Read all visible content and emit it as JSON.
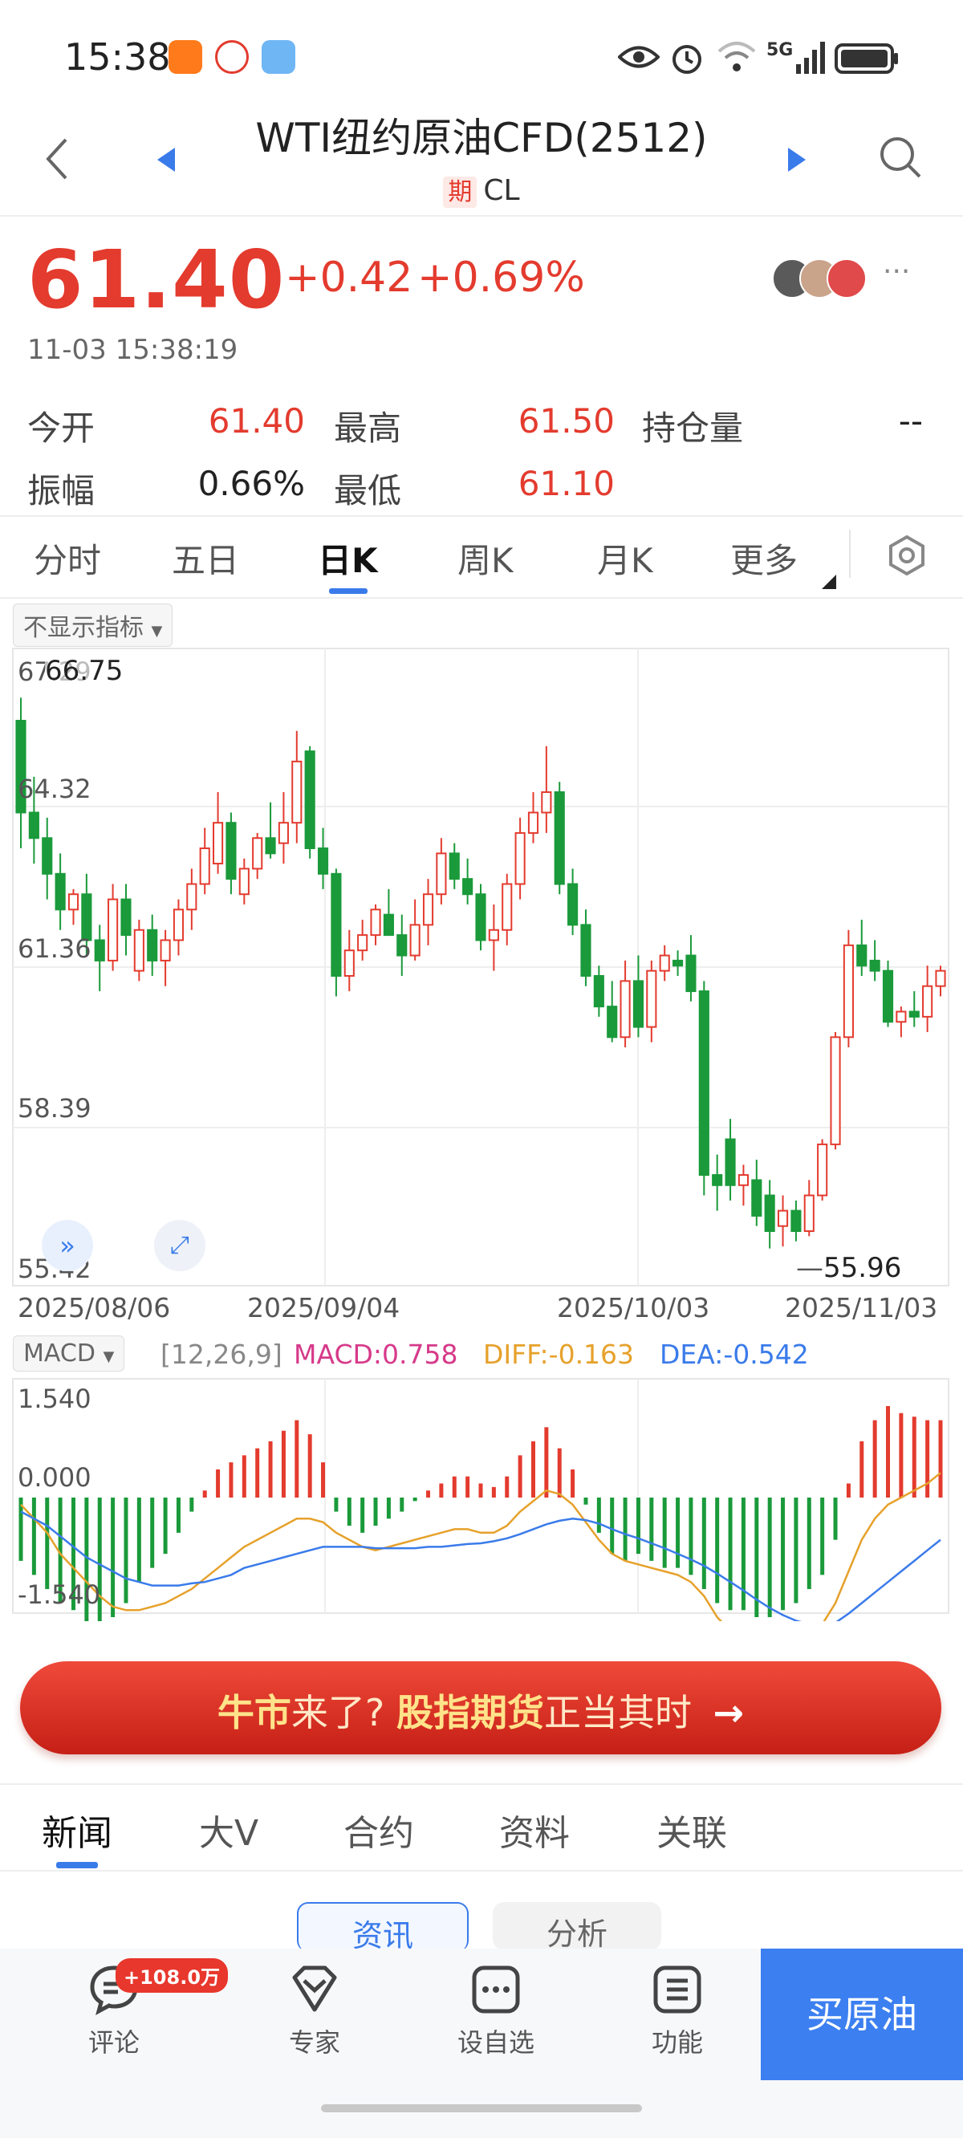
{
  "status": {
    "time": "15:38",
    "network": "5G"
  },
  "header": {
    "title": "WTI纽约原油CFD(2512)",
    "tag": "期",
    "code": "CL"
  },
  "quote": {
    "price": "61.40",
    "change": "+0.42",
    "change_pct": "+0.69%",
    "time": "11-03 15:38:19",
    "stats": [
      {
        "label": "今开",
        "value": "61.40",
        "color": "#e33b2e"
      },
      {
        "label": "最高",
        "value": "61.50",
        "color": "#e33b2e"
      },
      {
        "label": "持仓量",
        "value": "--",
        "color": "#222222"
      },
      {
        "label": "振幅",
        "value": "0.66%",
        "color": "#222222"
      },
      {
        "label": "最低",
        "value": "61.10",
        "color": "#e33b2e"
      }
    ]
  },
  "tabs": [
    "分时",
    "五日",
    "日K",
    "周K",
    "月K",
    "更多"
  ],
  "active_tab": "日K",
  "chart": {
    "indicator_toggle": "不显示指标",
    "y_ticks": [
      "67.29",
      "64.32",
      "61.36",
      "58.39",
      "55.42"
    ],
    "high_label": "66.75",
    "low_label": "55.96",
    "x_ticks": [
      "2025/08/06",
      "2025/09/04",
      "2025/10/03",
      "2025/11/03"
    ],
    "macd": {
      "selector": "MACD",
      "params": "[12,26,9]",
      "macd_label": "MACD:0.758",
      "diff_label": "DIFF:-0.163",
      "dea_label": "DEA:-0.542",
      "y_ticks": [
        "1.540",
        "0.000",
        "-1.540"
      ]
    }
  },
  "chart_data": {
    "type": "candlestick",
    "price_range": [
      55.42,
      67.29
    ],
    "up_color": "#e33b2e",
    "down_color": "#1a9a3a",
    "candles": [
      {
        "o": 66.3,
        "h": 66.75,
        "l": 63.8,
        "c": 64.5
      },
      {
        "o": 64.5,
        "h": 65.2,
        "l": 63.5,
        "c": 64.0
      },
      {
        "o": 64.0,
        "h": 64.4,
        "l": 62.8,
        "c": 63.3
      },
      {
        "o": 63.3,
        "h": 63.7,
        "l": 62.2,
        "c": 62.6
      },
      {
        "o": 62.6,
        "h": 63.0,
        "l": 62.3,
        "c": 62.9
      },
      {
        "o": 62.9,
        "h": 63.3,
        "l": 61.7,
        "c": 62.0
      },
      {
        "o": 62.0,
        "h": 62.3,
        "l": 61.0,
        "c": 61.6
      },
      {
        "o": 61.6,
        "h": 63.1,
        "l": 61.4,
        "c": 62.8
      },
      {
        "o": 62.8,
        "h": 63.1,
        "l": 61.7,
        "c": 62.1
      },
      {
        "o": 61.4,
        "h": 62.4,
        "l": 61.2,
        "c": 62.2
      },
      {
        "o": 62.2,
        "h": 62.5,
        "l": 61.3,
        "c": 61.6
      },
      {
        "o": 61.6,
        "h": 62.2,
        "l": 61.1,
        "c": 62.0
      },
      {
        "o": 62.0,
        "h": 62.8,
        "l": 61.7,
        "c": 62.6
      },
      {
        "o": 62.6,
        "h": 63.4,
        "l": 62.2,
        "c": 63.1
      },
      {
        "o": 63.1,
        "h": 64.2,
        "l": 62.9,
        "c": 63.8
      },
      {
        "o": 63.5,
        "h": 64.9,
        "l": 63.3,
        "c": 64.3
      },
      {
        "o": 64.3,
        "h": 64.5,
        "l": 62.9,
        "c": 63.2
      },
      {
        "o": 62.9,
        "h": 63.6,
        "l": 62.7,
        "c": 63.4
      },
      {
        "o": 63.4,
        "h": 64.1,
        "l": 63.2,
        "c": 64.0
      },
      {
        "o": 64.0,
        "h": 64.7,
        "l": 63.6,
        "c": 63.7
      },
      {
        "o": 63.9,
        "h": 64.9,
        "l": 63.5,
        "c": 64.3
      },
      {
        "o": 64.3,
        "h": 66.1,
        "l": 63.9,
        "c": 65.5
      },
      {
        "o": 65.7,
        "h": 65.8,
        "l": 63.6,
        "c": 63.8
      },
      {
        "o": 63.8,
        "h": 64.2,
        "l": 63.0,
        "c": 63.3
      },
      {
        "o": 63.3,
        "h": 63.4,
        "l": 60.9,
        "c": 61.3
      },
      {
        "o": 61.3,
        "h": 62.2,
        "l": 61.0,
        "c": 61.8
      },
      {
        "o": 61.8,
        "h": 62.4,
        "l": 61.6,
        "c": 62.1
      },
      {
        "o": 62.1,
        "h": 62.7,
        "l": 61.9,
        "c": 62.6
      },
      {
        "o": 62.5,
        "h": 63.0,
        "l": 62.3,
        "c": 62.1
      },
      {
        "o": 62.1,
        "h": 62.5,
        "l": 61.3,
        "c": 61.7
      },
      {
        "o": 61.7,
        "h": 62.8,
        "l": 61.6,
        "c": 62.3
      },
      {
        "o": 62.3,
        "h": 63.2,
        "l": 61.9,
        "c": 62.9
      },
      {
        "o": 62.9,
        "h": 64.0,
        "l": 62.7,
        "c": 63.7
      },
      {
        "o": 63.7,
        "h": 63.9,
        "l": 63.0,
        "c": 63.2
      },
      {
        "o": 63.2,
        "h": 63.6,
        "l": 62.7,
        "c": 62.9
      },
      {
        "o": 62.9,
        "h": 63.1,
        "l": 61.8,
        "c": 62.0
      },
      {
        "o": 62.0,
        "h": 62.7,
        "l": 61.4,
        "c": 62.2
      },
      {
        "o": 62.2,
        "h": 63.3,
        "l": 61.9,
        "c": 63.1
      },
      {
        "o": 63.1,
        "h": 64.4,
        "l": 62.8,
        "c": 64.1
      },
      {
        "o": 64.1,
        "h": 64.9,
        "l": 63.9,
        "c": 64.5
      },
      {
        "o": 64.5,
        "h": 65.8,
        "l": 64.1,
        "c": 64.9
      },
      {
        "o": 64.9,
        "h": 65.1,
        "l": 62.9,
        "c": 63.1
      },
      {
        "o": 63.1,
        "h": 63.4,
        "l": 62.1,
        "c": 62.3
      },
      {
        "o": 62.3,
        "h": 62.6,
        "l": 61.1,
        "c": 61.3
      },
      {
        "o": 61.3,
        "h": 61.5,
        "l": 60.5,
        "c": 60.7
      },
      {
        "o": 60.7,
        "h": 61.2,
        "l": 60.0,
        "c": 60.1
      },
      {
        "o": 60.1,
        "h": 61.6,
        "l": 59.9,
        "c": 61.2
      },
      {
        "o": 61.2,
        "h": 61.7,
        "l": 60.1,
        "c": 60.3
      },
      {
        "o": 60.3,
        "h": 61.6,
        "l": 60.0,
        "c": 61.4
      },
      {
        "o": 61.4,
        "h": 61.9,
        "l": 61.2,
        "c": 61.7
      },
      {
        "o": 61.6,
        "h": 61.8,
        "l": 61.3,
        "c": 61.5
      },
      {
        "o": 61.7,
        "h": 62.1,
        "l": 60.8,
        "c": 61.0
      },
      {
        "o": 61.0,
        "h": 61.2,
        "l": 57.0,
        "c": 57.4
      },
      {
        "o": 57.4,
        "h": 57.8,
        "l": 56.7,
        "c": 57.2
      },
      {
        "o": 58.1,
        "h": 58.5,
        "l": 56.9,
        "c": 57.2
      },
      {
        "o": 57.2,
        "h": 57.6,
        "l": 56.8,
        "c": 57.4
      },
      {
        "o": 57.3,
        "h": 57.7,
        "l": 56.4,
        "c": 56.6
      },
      {
        "o": 57.0,
        "h": 57.3,
        "l": 55.96,
        "c": 56.3
      },
      {
        "o": 56.4,
        "h": 57.0,
        "l": 56.0,
        "c": 56.7
      },
      {
        "o": 56.7,
        "h": 56.9,
        "l": 56.1,
        "c": 56.3
      },
      {
        "o": 56.3,
        "h": 57.3,
        "l": 56.2,
        "c": 57.0
      },
      {
        "o": 57.0,
        "h": 58.1,
        "l": 56.9,
        "c": 58.0
      },
      {
        "o": 58.0,
        "h": 60.2,
        "l": 57.9,
        "c": 60.1
      },
      {
        "o": 60.1,
        "h": 62.2,
        "l": 59.9,
        "c": 61.9
      },
      {
        "o": 61.9,
        "h": 62.4,
        "l": 61.3,
        "c": 61.5
      },
      {
        "o": 61.6,
        "h": 62.0,
        "l": 61.2,
        "c": 61.4
      },
      {
        "o": 61.4,
        "h": 61.6,
        "l": 60.3,
        "c": 60.4
      },
      {
        "o": 60.4,
        "h": 60.7,
        "l": 60.1,
        "c": 60.6
      },
      {
        "o": 60.6,
        "h": 61.0,
        "l": 60.3,
        "c": 60.5
      },
      {
        "o": 60.5,
        "h": 61.5,
        "l": 60.2,
        "c": 61.1
      },
      {
        "o": 61.1,
        "h": 61.5,
        "l": 60.9,
        "c": 61.4
      }
    ],
    "macd_range": [
      -1.54,
      1.54
    ],
    "macd_hist": [
      -0.9,
      -1.1,
      -1.3,
      -1.5,
      -1.6,
      -1.8,
      -1.9,
      -1.7,
      -1.5,
      -1.2,
      -1.0,
      -0.8,
      -0.5,
      -0.2,
      0.1,
      0.4,
      0.5,
      0.6,
      0.7,
      0.8,
      0.95,
      1.1,
      0.9,
      0.5,
      -0.2,
      -0.4,
      -0.5,
      -0.4,
      -0.3,
      -0.2,
      -0.05,
      0.1,
      0.2,
      0.3,
      0.3,
      0.2,
      0.15,
      0.3,
      0.6,
      0.8,
      1.0,
      0.7,
      0.4,
      -0.1,
      -0.5,
      -0.8,
      -0.9,
      -0.8,
      -0.9,
      -1.0,
      -1.0,
      -1.1,
      -1.3,
      -1.5,
      -1.6,
      -1.6,
      -1.7,
      -1.7,
      -1.6,
      -1.5,
      -1.3,
      -1.1,
      -0.6,
      0.2,
      0.8,
      1.1,
      1.3,
      1.2,
      1.15,
      1.1,
      1.1
    ],
    "diff": [
      -0.1,
      -0.3,
      -0.5,
      -0.8,
      -1.0,
      -1.2,
      -1.4,
      -1.55,
      -1.6,
      -1.6,
      -1.55,
      -1.5,
      -1.4,
      -1.3,
      -1.15,
      -1.0,
      -0.85,
      -0.7,
      -0.6,
      -0.5,
      -0.4,
      -0.3,
      -0.3,
      -0.35,
      -0.5,
      -0.6,
      -0.7,
      -0.75,
      -0.7,
      -0.65,
      -0.6,
      -0.55,
      -0.5,
      -0.45,
      -0.45,
      -0.5,
      -0.5,
      -0.4,
      -0.2,
      -0.05,
      0.1,
      0.05,
      -0.1,
      -0.35,
      -0.6,
      -0.8,
      -0.9,
      -0.95,
      -1.0,
      -1.05,
      -1.1,
      -1.2,
      -1.4,
      -1.7,
      -1.9,
      -2.0,
      -2.05,
      -2.1,
      -2.1,
      -2.05,
      -1.95,
      -1.8,
      -1.5,
      -1.05,
      -0.6,
      -0.3,
      -0.1,
      0.0,
      0.1,
      0.2,
      0.35
    ],
    "dea": [
      -0.2,
      -0.3,
      -0.4,
      -0.55,
      -0.7,
      -0.85,
      -0.95,
      -1.05,
      -1.15,
      -1.2,
      -1.25,
      -1.25,
      -1.25,
      -1.22,
      -1.2,
      -1.15,
      -1.1,
      -1.0,
      -0.95,
      -0.9,
      -0.85,
      -0.8,
      -0.75,
      -0.7,
      -0.7,
      -0.7,
      -0.7,
      -0.72,
      -0.72,
      -0.72,
      -0.72,
      -0.7,
      -0.7,
      -0.68,
      -0.66,
      -0.65,
      -0.62,
      -0.58,
      -0.52,
      -0.45,
      -0.38,
      -0.33,
      -0.3,
      -0.32,
      -0.37,
      -0.45,
      -0.52,
      -0.58,
      -0.65,
      -0.72,
      -0.8,
      -0.88,
      -0.97,
      -1.08,
      -1.2,
      -1.32,
      -1.45,
      -1.57,
      -1.67,
      -1.75,
      -1.8,
      -1.82,
      -1.78,
      -1.65,
      -1.5,
      -1.35,
      -1.2,
      -1.05,
      -0.9,
      -0.75,
      -0.6
    ]
  },
  "banner": {
    "part1": "牛市",
    "part2": "来了? ",
    "part3": "股指期货",
    "part4": "正当其时",
    "arrow": "→"
  },
  "news_tabs": [
    "新闻",
    "大V",
    "合约",
    "资料",
    "关联"
  ],
  "subtabs": [
    "资讯",
    "分析"
  ],
  "bottom_nav": {
    "items": [
      "评论",
      "专家",
      "设自选",
      "功能"
    ],
    "badge": "+108.0万",
    "buy_label": "买原油"
  }
}
